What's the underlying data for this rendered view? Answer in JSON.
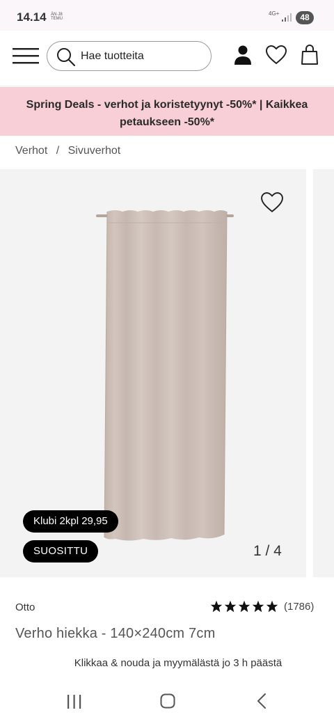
{
  "status_bar": {
    "time": "14.14",
    "mini_icons": "ÄN·J8 TEMU",
    "network": "4G+",
    "battery": "48"
  },
  "header": {
    "search_placeholder": "Hae tuotteita",
    "icons": [
      "menu-icon",
      "search-icon",
      "user-icon",
      "heart-icon",
      "shopping-bag-icon"
    ]
  },
  "promo": {
    "text": "Spring Deals - verhot ja koristetyynyt -50%* | Kaikkea petaukseen -50%*"
  },
  "breadcrumb": {
    "items": [
      "Verhot",
      "Sivuverhot"
    ],
    "separator": "/"
  },
  "product": {
    "image_badges": {
      "club": "Klubi 2kpl 29,95",
      "popular": "SUOSITTU"
    },
    "image_counter": "1 / 4",
    "brand": "Otto",
    "rating_stars": 5,
    "review_count": "(1786)",
    "title": "Verho hiekka - 140×240cm 7cm",
    "pickup": "Klikkaa & nouda ja myymälästä jo 3 h päästä"
  },
  "colors": {
    "promo_bg": "#f8cfd6",
    "image_bg": "#f3f3f3",
    "curtain": "#cbbdb5",
    "badge_bg": "#000000"
  }
}
